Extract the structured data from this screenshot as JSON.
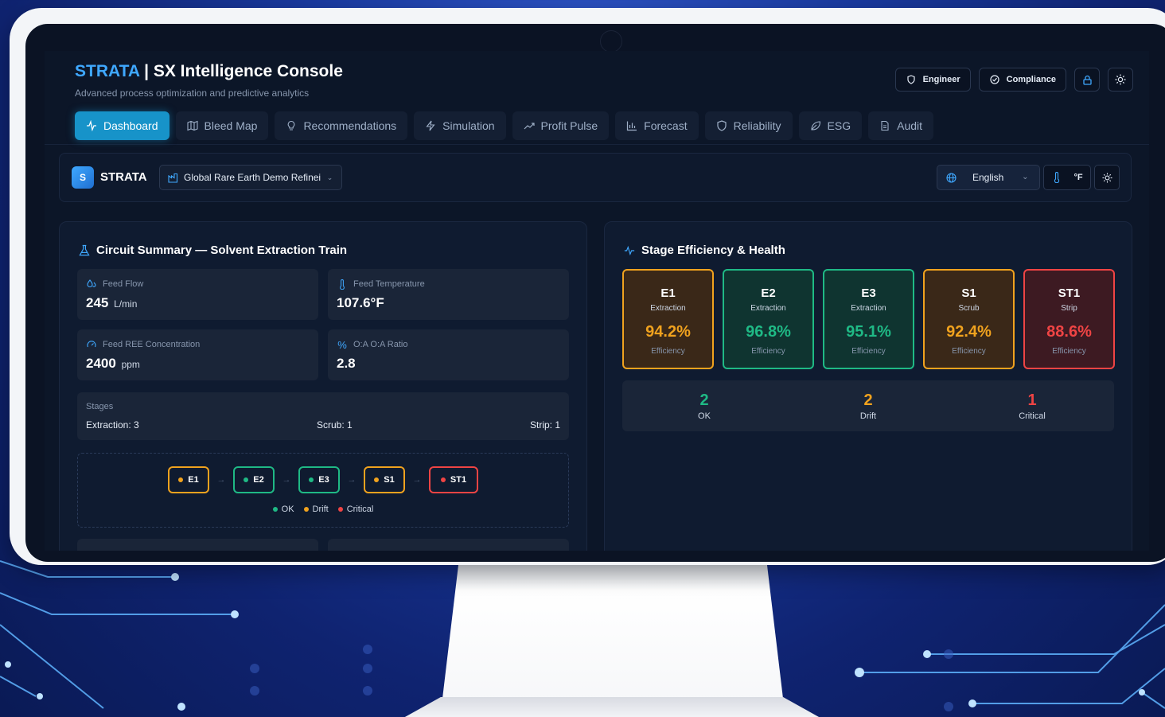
{
  "colors": {
    "ok": "#1fb985",
    "drift": "#f0a21e",
    "critical": "#ef4444",
    "accent": "#3fa8ff",
    "active_tab": "#1793c9"
  },
  "header": {
    "brand": "STRATA",
    "separator": " | ",
    "title": "SX Intelligence Console",
    "subtitle": "Advanced process optimization and predictive analytics",
    "role_label": "Engineer",
    "compliance_label": "Compliance",
    "icons": {
      "role": "shield-icon",
      "compliance": "check-circle-icon",
      "lock": "lock-icon",
      "theme": "sun-icon"
    }
  },
  "tabs": [
    {
      "label": "Dashboard",
      "icon": "activity-icon",
      "active": true
    },
    {
      "label": "Bleed Map",
      "icon": "map-icon"
    },
    {
      "label": "Recommendations",
      "icon": "lightbulb-icon"
    },
    {
      "label": "Simulation",
      "icon": "zap-icon"
    },
    {
      "label": "Profit Pulse",
      "icon": "trending-up-icon"
    },
    {
      "label": "Forecast",
      "icon": "bar-chart-icon"
    },
    {
      "label": "Reliability",
      "icon": "shield-icon"
    },
    {
      "label": "ESG",
      "icon": "leaf-icon"
    },
    {
      "label": "Audit",
      "icon": "file-icon"
    }
  ],
  "sitebar": {
    "logo_letter": "S",
    "name": "STRATA",
    "site_value": "Global Rare Earth Demo Refinei",
    "language": "English",
    "unit": "°F"
  },
  "circuit": {
    "title": "Circuit Summary — Solvent Extraction Train",
    "metrics": [
      {
        "label": "Feed Flow",
        "value": "245",
        "unit": "L/min",
        "icon": "droplets-icon"
      },
      {
        "label": "Feed Temperature",
        "value": "107.6°F",
        "unit": "",
        "icon": "thermometer-icon"
      },
      {
        "label": "Feed REE Concentration",
        "value": "2400",
        "unit": "ppm",
        "icon": "gauge-icon"
      },
      {
        "label": "O:A O:A Ratio",
        "value": "2.8",
        "unit": "",
        "icon": "percent-icon"
      }
    ],
    "stages_header": "Stages",
    "extraction": "Extraction: 3",
    "scrub": "Scrub: 1",
    "strip": "Strip: 1",
    "flow": [
      {
        "id": "E1",
        "status": "drift"
      },
      {
        "id": "E2",
        "status": "ok"
      },
      {
        "id": "E3",
        "status": "ok"
      },
      {
        "id": "S1",
        "status": "drift"
      },
      {
        "id": "ST1",
        "status": "critical"
      }
    ],
    "arrow": "→",
    "legend": {
      "ok": "OK",
      "drift": "Drift",
      "critical": "Critical"
    }
  },
  "efficiency": {
    "title": "Stage Efficiency & Health",
    "efficiency_label": "Efficiency",
    "cards": [
      {
        "id": "E1",
        "type": "Extraction",
        "value": "94.2%",
        "status": "drift"
      },
      {
        "id": "E2",
        "type": "Extraction",
        "value": "96.8%",
        "status": "ok"
      },
      {
        "id": "E3",
        "type": "Extraction",
        "value": "95.1%",
        "status": "ok"
      },
      {
        "id": "S1",
        "type": "Scrub",
        "value": "92.4%",
        "status": "drift"
      },
      {
        "id": "ST1",
        "type": "Strip",
        "value": "88.6%",
        "status": "critical"
      }
    ],
    "summary": [
      {
        "count": "2",
        "label": "OK",
        "status": "ok"
      },
      {
        "count": "2",
        "label": "Drift",
        "status": "drift"
      },
      {
        "count": "1",
        "label": "Critical",
        "status": "critical"
      }
    ]
  }
}
